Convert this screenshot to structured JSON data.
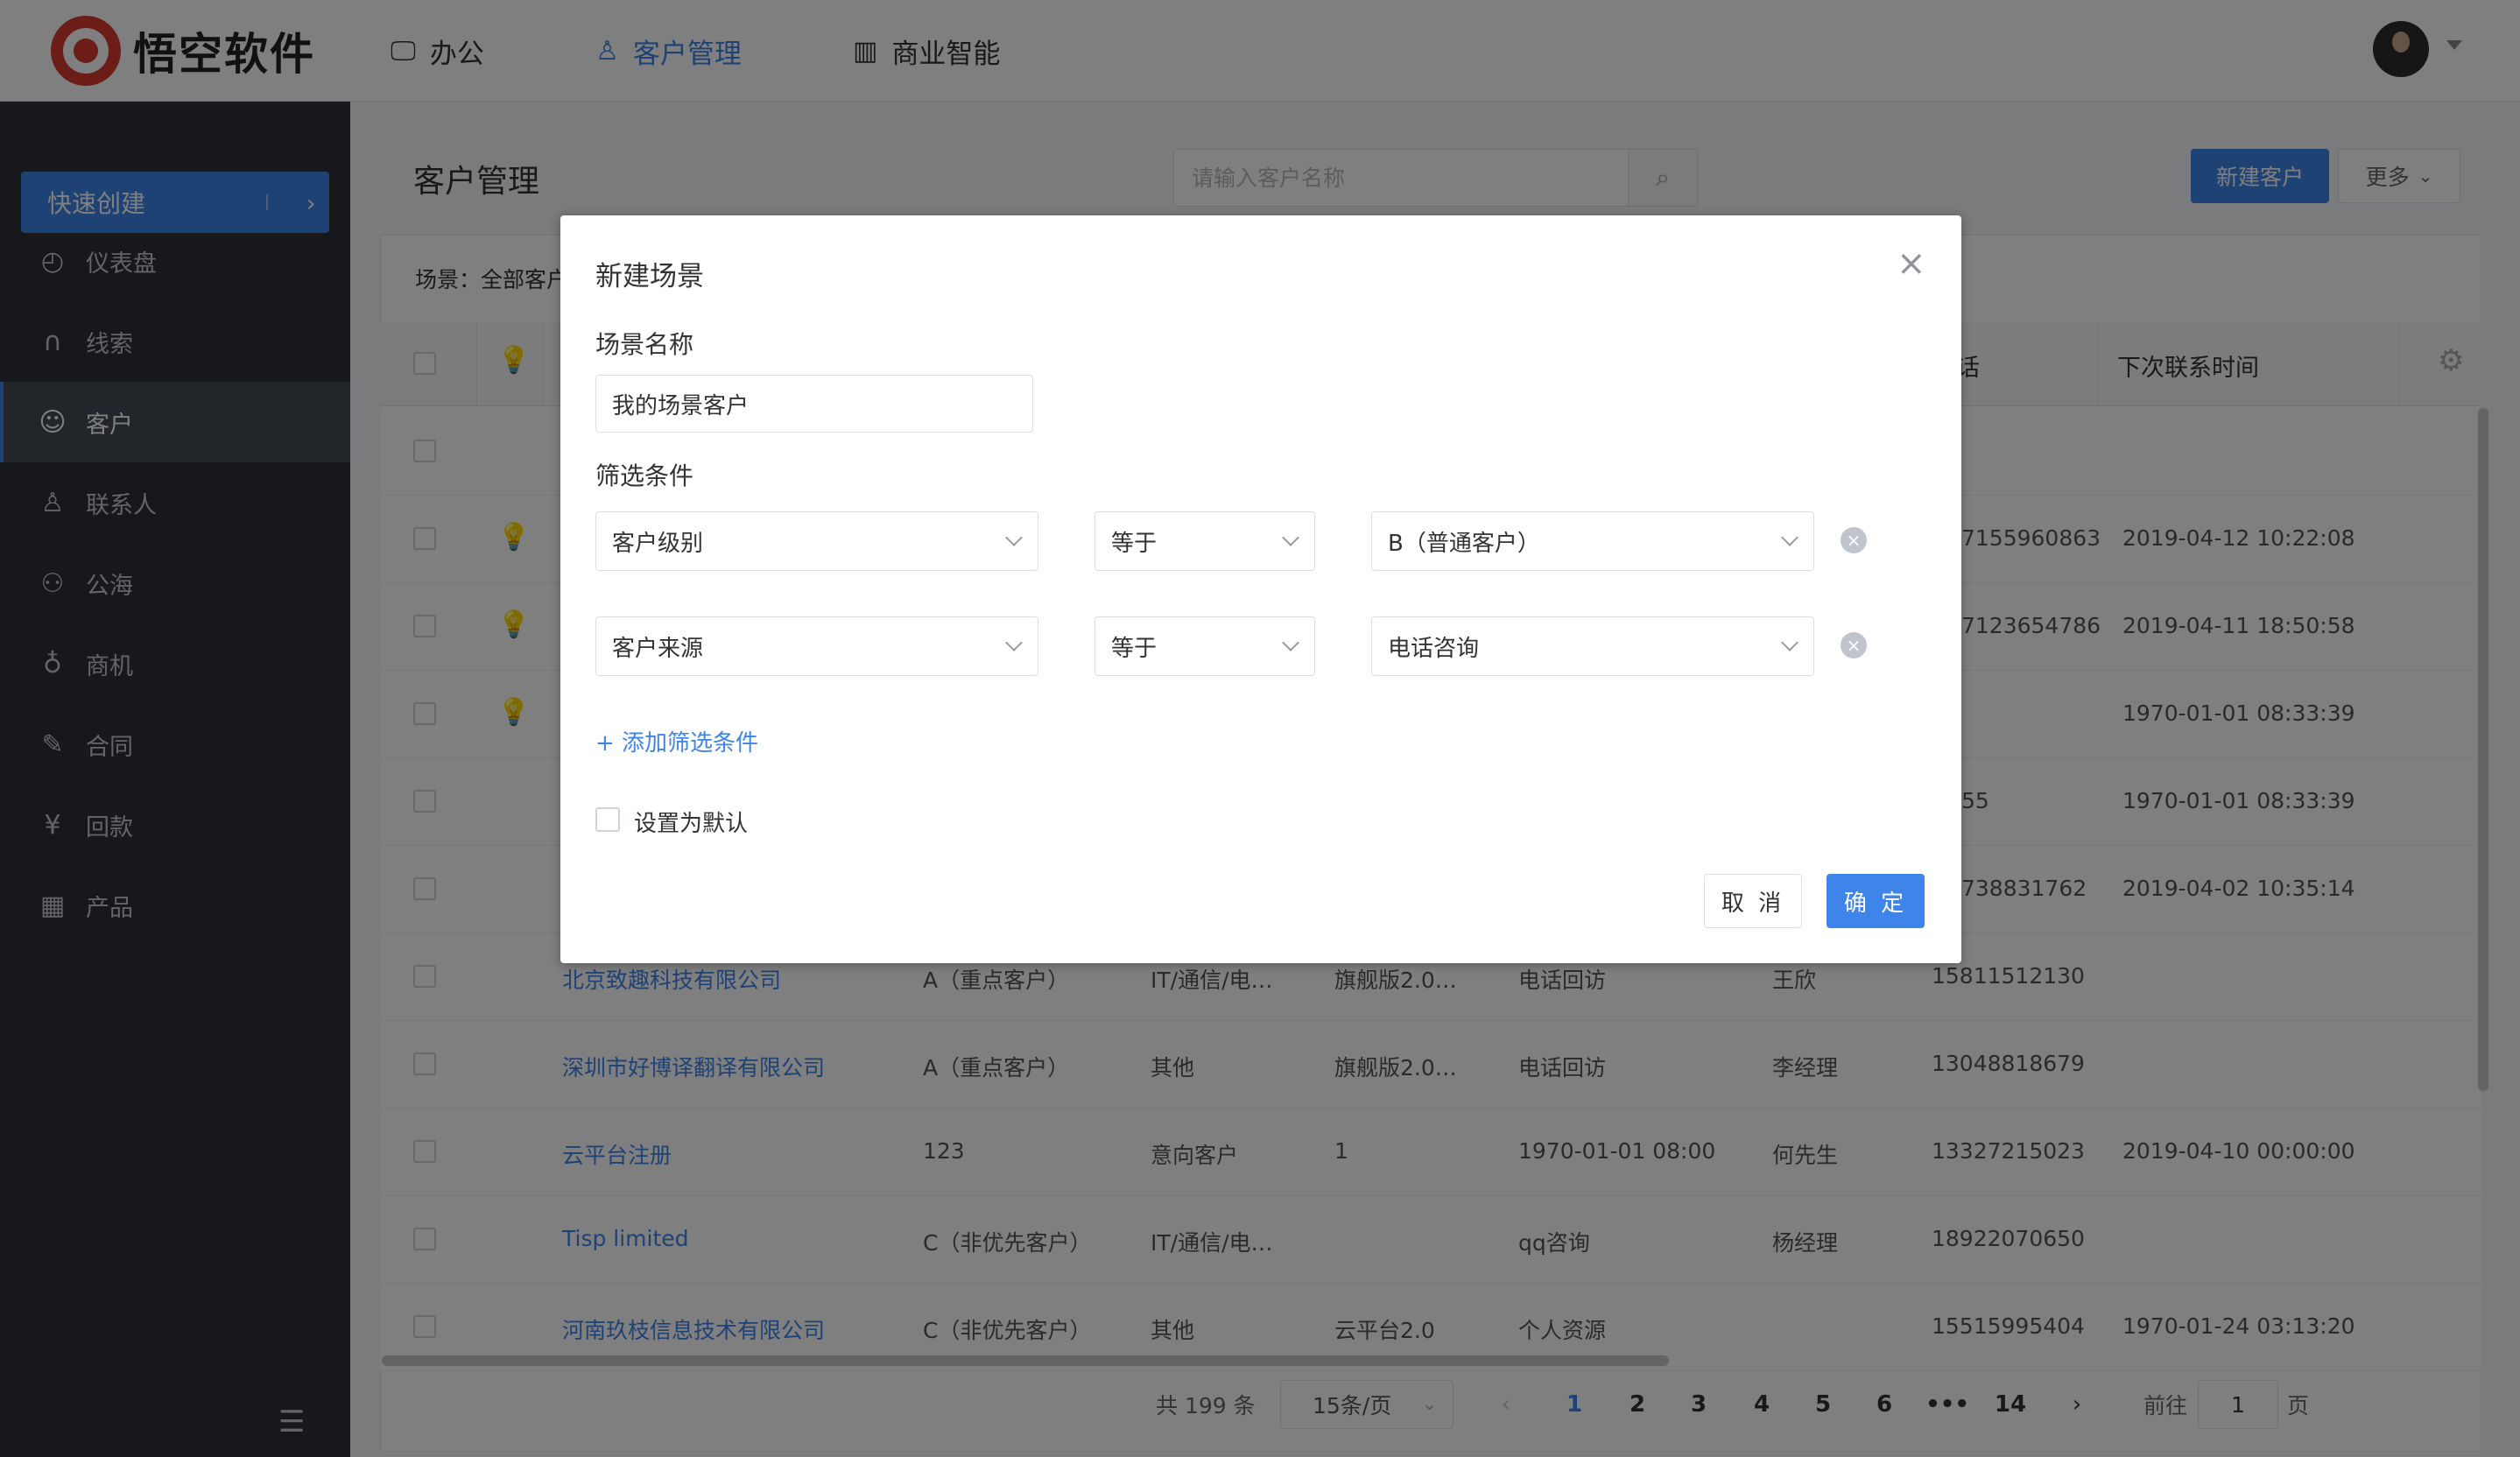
{
  "app": {
    "logo_text": "悟空软件"
  },
  "topnav": [
    {
      "label": "办公",
      "icon": "monitor-icon"
    },
    {
      "label": "客户管理",
      "icon": "user-icon",
      "active": true
    },
    {
      "label": "商业智能",
      "icon": "bar-chart-icon"
    }
  ],
  "sidebar": {
    "quick_create": "快速创建",
    "items": [
      {
        "label": "仪表盘",
        "glyph": "◴"
      },
      {
        "label": "线索",
        "glyph": "∩"
      },
      {
        "label": "客户",
        "glyph": "☺",
        "active": true
      },
      {
        "label": "联系人",
        "glyph": "♙"
      },
      {
        "label": "公海",
        "glyph": "⚇"
      },
      {
        "label": "商机",
        "glyph": "♁"
      },
      {
        "label": "合同",
        "glyph": "✎"
      },
      {
        "label": "回款",
        "glyph": "¥"
      },
      {
        "label": "产品",
        "glyph": "▦"
      }
    ]
  },
  "main": {
    "title": "客户管理",
    "search_placeholder": "请输入客户名称",
    "new_customer": "新建客户",
    "more": "更多",
    "scene_label": "场景：全部客户"
  },
  "table": {
    "headers": {
      "phone": "话",
      "next_contact": "下次联系时间"
    },
    "hidden_rows": [
      {
        "phone": "7155960863",
        "next": "2019-04-12 10:22:08",
        "bulb": true
      },
      {
        "phone": "7123654786",
        "next": "2019-04-11 18:50:58",
        "bulb": true
      },
      {
        "phone": "",
        "next": "1970-01-01 08:33:39",
        "bulb": true
      },
      {
        "phone": "55",
        "next": "1970-01-01 08:33:39",
        "bulb": false
      },
      {
        "phone": "738831762",
        "next": "2019-04-02 10:35:14",
        "bulb": false
      }
    ],
    "rows": [
      {
        "name": "北京致趣科技有限公司",
        "level": "A（重点客户）",
        "industry": "IT/通信/电…",
        "source": "旗舰版2.0…",
        "followup": "电话回访",
        "contact": "王欣",
        "phone": "15811512130",
        "next": ""
      },
      {
        "name": "深圳市好博译翻译有限公司",
        "level": "A（重点客户）",
        "industry": "其他",
        "source": "旗舰版2.0…",
        "followup": "电话回访",
        "contact": "李经理",
        "phone": "13048818679",
        "next": ""
      },
      {
        "name": "云平台注册",
        "level": "123",
        "industry": "意向客户",
        "source": "1",
        "followup": "1970-01-01 08:00",
        "contact": "何先生",
        "phone": "13327215023",
        "next": "2019-04-10 00:00:00"
      },
      {
        "name": "Tisp limited",
        "level": "C（非优先客户）",
        "industry": "IT/通信/电…",
        "source": "",
        "followup": "qq咨询",
        "contact": "杨经理",
        "phone": "18922070650",
        "next": ""
      },
      {
        "name": "河南玖枝信息技术有限公司",
        "level": "C（非优先客户）",
        "industry": "其他",
        "source": "云平台2.0",
        "followup": "个人资源",
        "contact": "",
        "phone": "15515995404",
        "next": "1970-01-24 03:13:20"
      }
    ]
  },
  "pagination": {
    "total": "共 199 条",
    "page_size": "15条/页",
    "pages": [
      "1",
      "2",
      "3",
      "4",
      "5",
      "6",
      "•••",
      "14"
    ],
    "goto_prefix": "前往",
    "goto_value": "1",
    "goto_suffix": "页"
  },
  "dialog": {
    "title": "新建场景",
    "name_label": "场景名称",
    "name_value": "我的场景客户",
    "filter_label": "筛选条件",
    "conditions": [
      {
        "field": "客户级别",
        "op": "等于",
        "value": "B（普通客户）"
      },
      {
        "field": "客户来源",
        "op": "等于",
        "value": "电话咨询"
      }
    ],
    "add_condition": "+ 添加筛选条件",
    "default_label": "设置为默认",
    "cancel": "取 消",
    "ok": "确 定"
  }
}
